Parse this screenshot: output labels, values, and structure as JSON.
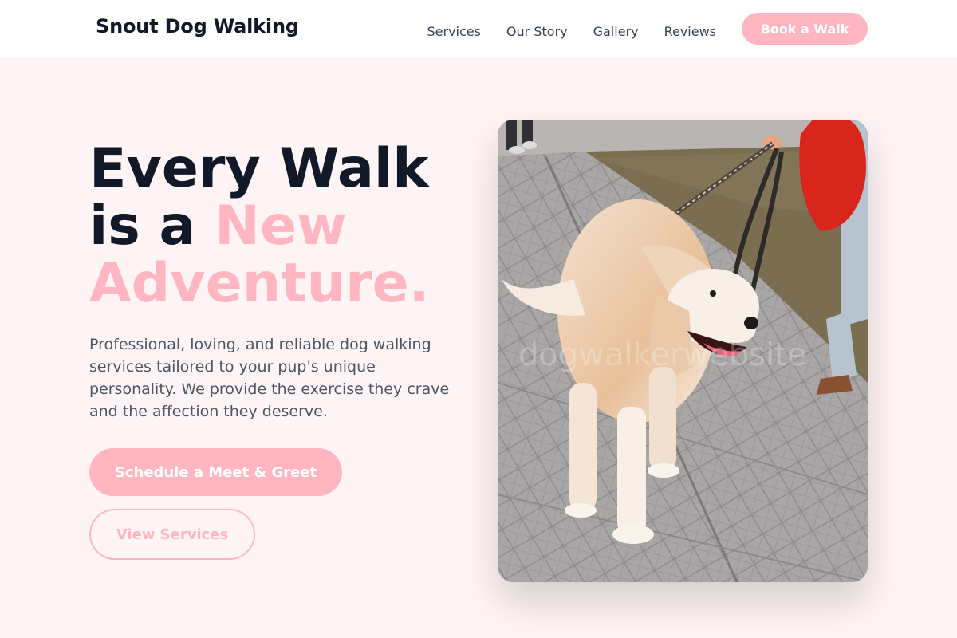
{
  "header": {
    "logo": "Snout Dog Walking",
    "nav": [
      "Services",
      "Our Story",
      "Gallery",
      "Reviews"
    ],
    "cta": "Book a Walk"
  },
  "hero": {
    "title_line1": "Every Walk",
    "title_line2_prefix": "is a ",
    "title_line2_accent": "New",
    "title_line3_accent": "Adventure.",
    "description": "Professional, loving, and reliable dog walking services tailored to your pup's unique personality. We provide the exercise they crave and the affection they deserve.",
    "primary_button": "Schedule a Meet & Greet",
    "secondary_button": "View Services"
  },
  "image": {
    "watermark": "dogwalkerwebsite"
  },
  "colors": {
    "accent": "#ffb6c1",
    "heading": "#111827",
    "body_text": "#4b5563",
    "background": "#fef4f5"
  }
}
